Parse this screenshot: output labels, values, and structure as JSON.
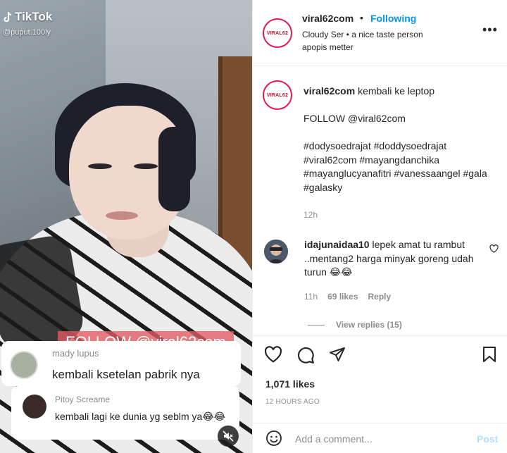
{
  "media": {
    "watermark_brand": "TikTok",
    "watermark_user": "@puput.100ly",
    "follow_banner": "FOLLOW @viral62com",
    "comments": [
      {
        "name": "mady lupus",
        "text": "kembali ksetelan pabrik nya"
      },
      {
        "name": "Pitoy Screame",
        "text": "kembali lagi ke dunia yg seblm ya😂😂"
      }
    ]
  },
  "header": {
    "username": "viral62com",
    "separator": "•",
    "follow_status": "Following",
    "subtitle": "Cloudy Ser • a nice taste person apopis metter",
    "logo_text": "VIRAL62"
  },
  "caption": {
    "username": "viral62com",
    "title": "kembali ke leptop",
    "follow_line": "FOLLOW @viral62com",
    "hashtags": "#dodysoedrajat #doddysoedrajat #viral62com #mayangdanchika #mayanglucyanafitri #vanessaangel #gala #galasky",
    "time": "12h"
  },
  "comment": {
    "username": "idajunaidaa10",
    "text": "lepek amat tu rambut ..mentang2 harga minyak goreng udah turun 😂😂",
    "time": "11h",
    "likes": "69 likes",
    "reply": "Reply",
    "view_replies": "View replies (15)"
  },
  "actions": {
    "likes": "1,071 likes",
    "posted": "12 HOURS AGO"
  },
  "add_comment": {
    "placeholder": "Add a comment...",
    "post_label": "Post"
  },
  "colors": {
    "link_blue": "#0095f6",
    "post_disabled": "#b2dffc",
    "logo_ring": "#e0195c"
  }
}
